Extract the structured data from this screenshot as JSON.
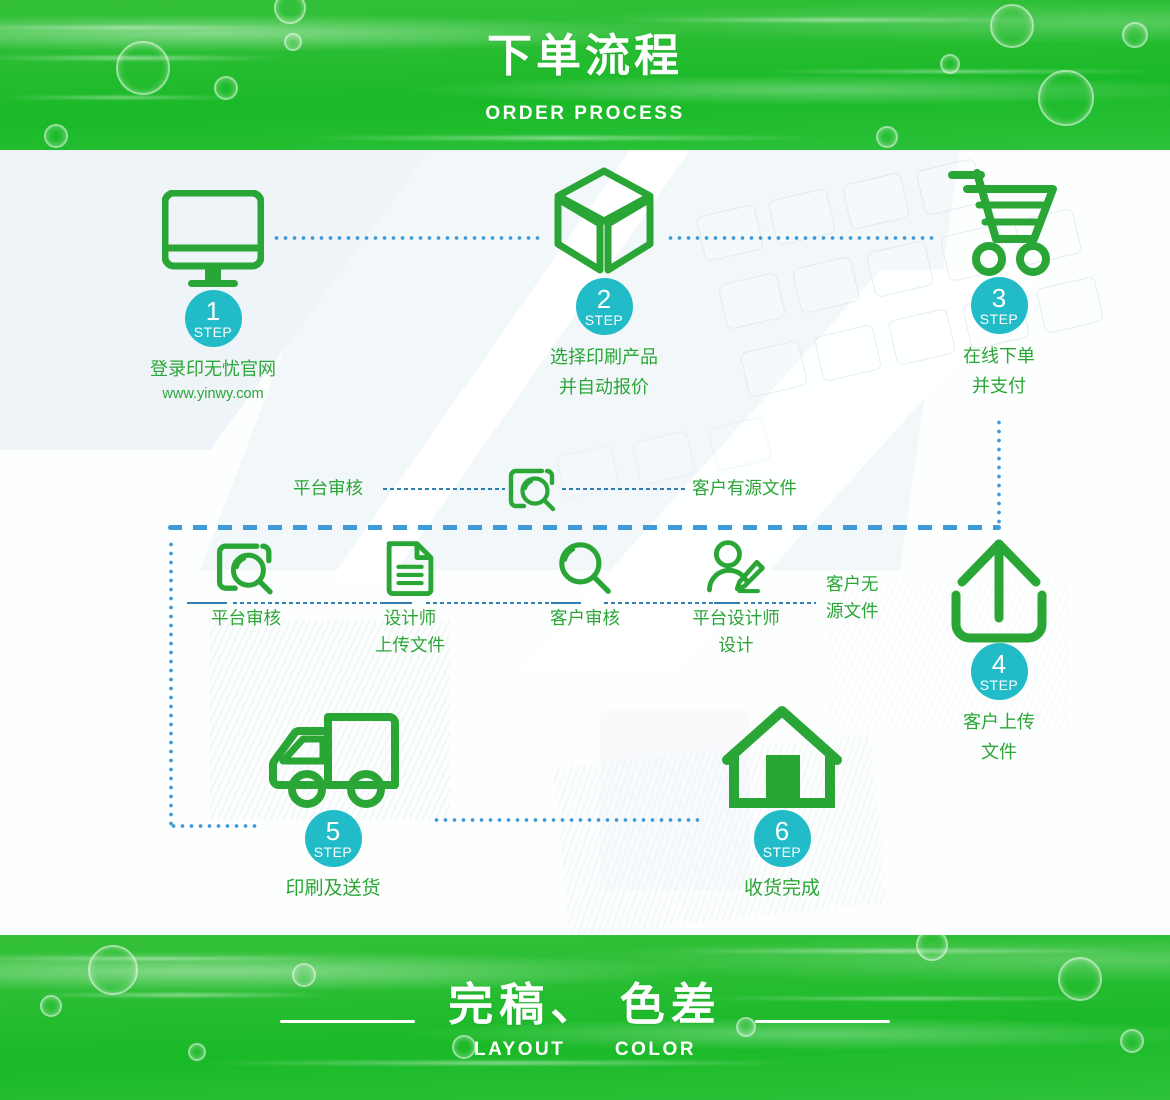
{
  "header": {
    "title_cn": "下单流程",
    "title_en": "ORDER PROCESS"
  },
  "footer": {
    "title_cn": "完稿、 色差",
    "title_en_left": "LAYOUT",
    "title_en_right": "COLOR"
  },
  "colors": {
    "brand_green": "#2aa636",
    "icon_green": "#2aa636",
    "badge_teal": "#22bcc8",
    "connector_blue": "#3d9cd8",
    "banner_green": "#28bd32"
  },
  "steps": [
    {
      "num": "1",
      "step_label": "STEP",
      "icon": "monitor-icon",
      "caption_lines": [
        "登录印无忧官网"
      ],
      "url": "www.yinwy.com"
    },
    {
      "num": "2",
      "step_label": "STEP",
      "icon": "box-3d-icon",
      "caption_lines": [
        "选择印刷产品",
        "并自动报价"
      ],
      "url": ""
    },
    {
      "num": "3",
      "step_label": "STEP",
      "icon": "shopping-cart-icon",
      "caption_lines": [
        "在线下单",
        "并支付"
      ],
      "url": ""
    },
    {
      "num": "4",
      "step_label": "STEP",
      "icon": "upload-icon",
      "caption_lines": [
        "客户上传",
        "文件"
      ],
      "url": ""
    },
    {
      "num": "5",
      "step_label": "STEP",
      "icon": "truck-icon",
      "caption_lines": [
        "印刷及送货"
      ],
      "url": ""
    },
    {
      "num": "6",
      "step_label": "STEP",
      "icon": "house-icon",
      "caption_lines": [
        "收货完成"
      ],
      "url": ""
    }
  ],
  "branch": {
    "top_left_label": "平台审核",
    "top_right_label": "客户有源文件",
    "top_icon": "document-search-icon",
    "right_label_lines": [
      "客户无",
      "源文件"
    ],
    "nodes": [
      {
        "icon": "document-search-icon",
        "caption_lines": [
          "平台审核"
        ]
      },
      {
        "icon": "document-lines-icon",
        "caption_lines": [
          "设计师",
          "上传文件"
        ]
      },
      {
        "icon": "magnifier-icon",
        "caption_lines": [
          "客户审核"
        ]
      },
      {
        "icon": "designer-pen-icon",
        "caption_lines": [
          "平台设计师",
          "设计"
        ]
      }
    ]
  }
}
